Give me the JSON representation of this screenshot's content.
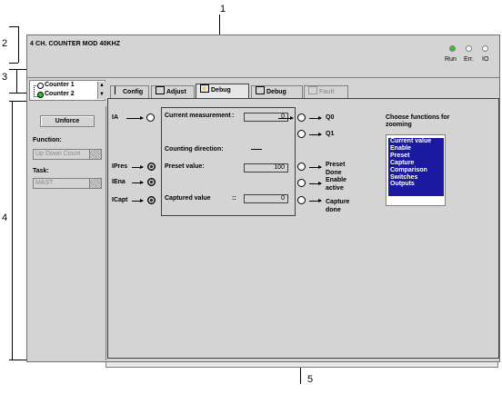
{
  "callouts": {
    "c1": "1",
    "c2": "2",
    "c3": "3",
    "c4": "4",
    "c5": "5"
  },
  "module": {
    "title": "4 CH. COUNTER MOD 40KHZ"
  },
  "leds": [
    {
      "label": "Run",
      "color": "#2ec12e"
    },
    {
      "label": "Err.",
      "color": "#ffffff"
    },
    {
      "label": "IO",
      "color": "#ffffff"
    }
  ],
  "channels": [
    {
      "label": "Counter 1",
      "color": "#ffffff"
    },
    {
      "label": "Counter 2",
      "color": "#2ec12e"
    }
  ],
  "tabs": [
    {
      "label": "Config",
      "icon": "config-icon"
    },
    {
      "label": "Adjust",
      "icon": "adjust-icon"
    },
    {
      "label": "Debug",
      "icon": "debug-icon",
      "active": true
    },
    {
      "label": "Debug",
      "icon": "debug-icon"
    },
    {
      "label": "Fault",
      "icon": "fault-icon",
      "disabled": true
    }
  ],
  "left": {
    "unforce_label": "Unforce",
    "function_label": "Function:",
    "function_value": "Up Down Count",
    "task_label": "Task:",
    "task_value": "MAST"
  },
  "debug": {
    "ia": "IA",
    "ipres": "IPres",
    "iena": "IEna",
    "icapt": "ICapt",
    "current_measurement_label": "Current measurement",
    "current_measurement_colon": ":",
    "current_measurement_value": "0",
    "counting_direction_label": "Counting direction:",
    "preset_value_label": "Preset value:",
    "preset_value": "100",
    "captured_value_label": "Captured value",
    "captured_value_colon": "::",
    "captured_value": "0",
    "q0": "Q0",
    "q1": "Q1",
    "preset_done": "Preset\nDone",
    "enable_active": "Enable\nactive",
    "capture_done": "Capture\ndone"
  },
  "zoom": {
    "label": "Choose functions for zooming",
    "items": [
      "Current value",
      "Enable",
      "Preset",
      "Capture",
      "Comparison",
      "Switches",
      "Outputs"
    ]
  },
  "colors": {
    "run_led": "#2ec12e",
    "list_selection": "#1a1aa0",
    "panel": "#d4d4d4"
  }
}
